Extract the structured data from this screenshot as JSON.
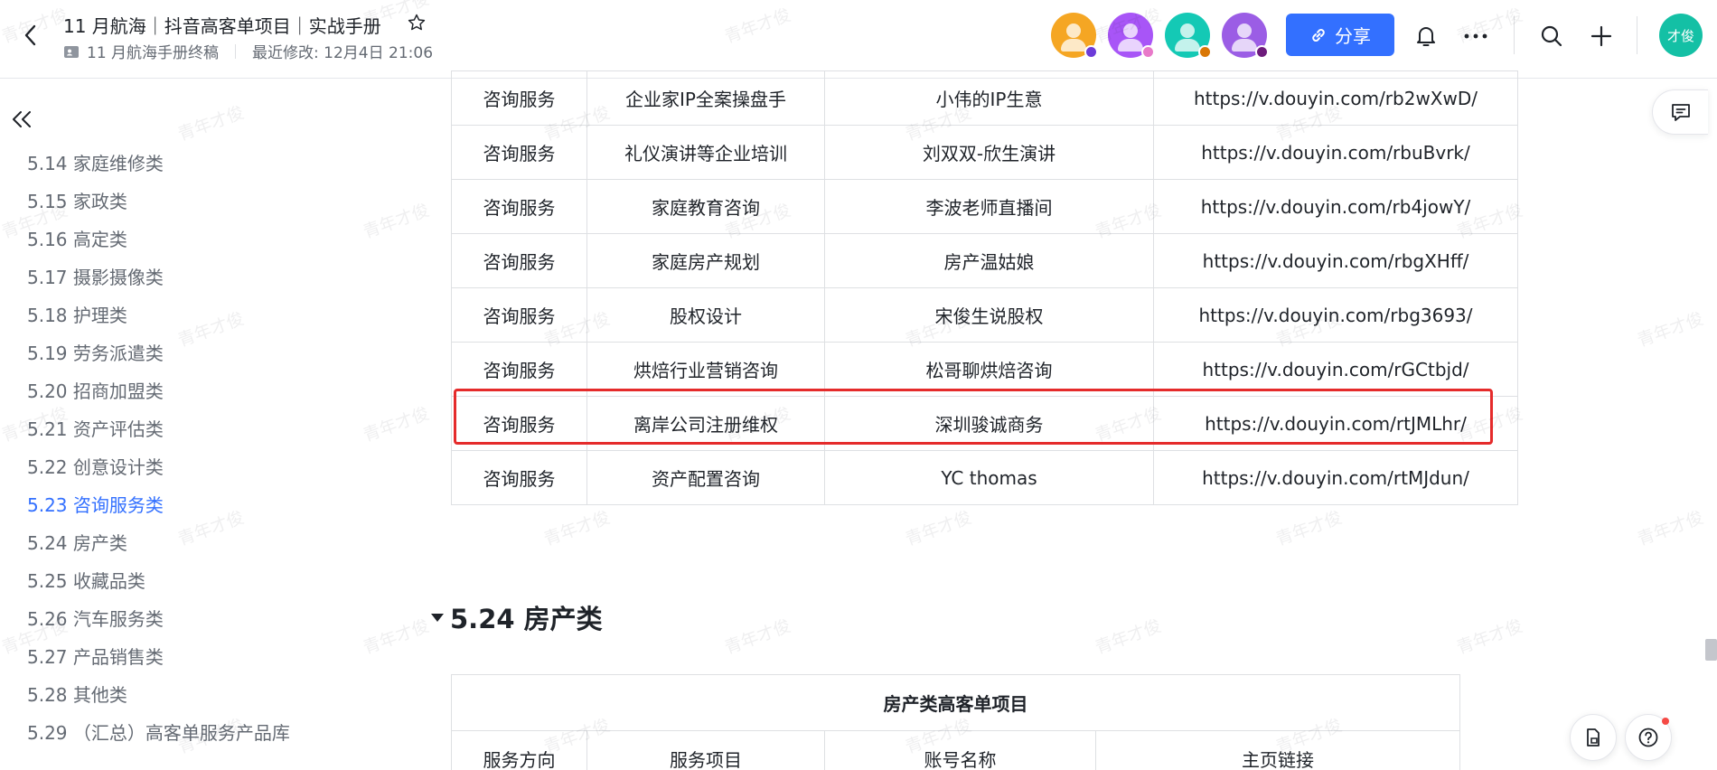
{
  "header": {
    "title": "11 月航海｜抖音高客单项目｜实战手册",
    "folder": "11 月航海手册终稿",
    "last_modified": "最近修改: 12月4日 21:06",
    "share_label": "分享",
    "user_avatar_text": "才俊"
  },
  "collaborators": [
    {
      "bg": "#f5a623",
      "dot": "#6c3bd9"
    },
    {
      "bg": "#a855f7",
      "dot": "#e879c9"
    },
    {
      "bg": "#14c9b5",
      "dot": "#d97706"
    },
    {
      "bg": "#9b5de5",
      "dot": "#6d1b7b"
    }
  ],
  "sidebar": {
    "items": [
      {
        "label": "5.14 家庭维修类"
      },
      {
        "label": "5.15 家政类"
      },
      {
        "label": "5.16 高定类"
      },
      {
        "label": "5.17 摄影摄像类"
      },
      {
        "label": "5.18 护理类"
      },
      {
        "label": "5.19 劳务派遣类"
      },
      {
        "label": "5.20 招商加盟类"
      },
      {
        "label": "5.21 资产评估类"
      },
      {
        "label": "5.22 创意设计类"
      },
      {
        "label": "5.23 咨询服务类"
      },
      {
        "label": "5.24 房产类"
      },
      {
        "label": "5.25 收藏品类"
      },
      {
        "label": "5.26 汽车服务类"
      },
      {
        "label": "5.27 产品销售类"
      },
      {
        "label": "5.28 其他类"
      },
      {
        "label": "5.29 （汇总）高客单服务产品库"
      }
    ],
    "active_index": 9
  },
  "consulting_table": {
    "rows": [
      [
        "咨询服务",
        "企业家IP全案操盘手",
        "小伟的IP生意",
        "https://v.douyin.com/rb2wXwD/"
      ],
      [
        "咨询服务",
        "礼仪演讲等企业培训",
        "刘双双-欣生演讲",
        "https://v.douyin.com/rbuBvrk/"
      ],
      [
        "咨询服务",
        "家庭教育咨询",
        "李波老师直播间",
        "https://v.douyin.com/rb4jowY/"
      ],
      [
        "咨询服务",
        "家庭房产规划",
        "房产温姑娘",
        "https://v.douyin.com/rbgXHff/"
      ],
      [
        "咨询服务",
        "股权设计",
        "宋俊生说股权",
        "https://v.douyin.com/rbg3693/"
      ],
      [
        "咨询服务",
        "烘焙行业营销咨询",
        "松哥聊烘焙咨询",
        "https://v.douyin.com/rGCtbjd/"
      ],
      [
        "咨询服务",
        "离岸公司注册维权",
        "深圳骏诚商务",
        "https://v.douyin.com/rtJMLhr/"
      ],
      [
        "咨询服务",
        "资产配置咨询",
        "YC thomas",
        "https://v.douyin.com/rtMJdun/"
      ]
    ],
    "highlighted_row": 6
  },
  "section": {
    "heading": "5.24 房产类"
  },
  "realestate_table": {
    "caption": "房产类高客单项目",
    "headers": [
      "服务方向",
      "服务项目",
      "账号名称",
      "主页链接"
    ]
  },
  "watermark": "青年才俊"
}
